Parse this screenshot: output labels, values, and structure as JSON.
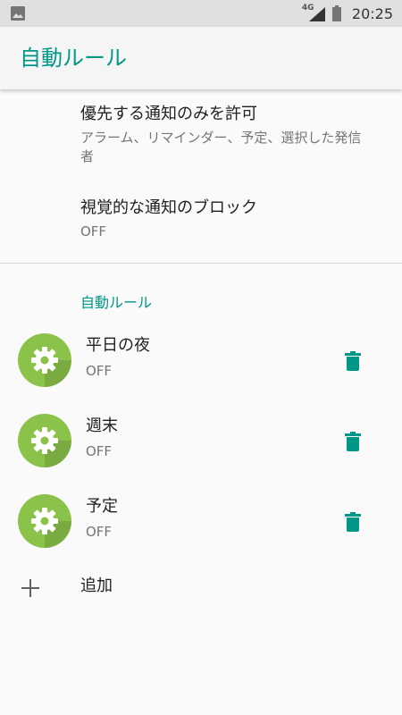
{
  "status_bar": {
    "network_label": "4G",
    "time": "20:25",
    "icons": [
      "image-notification-icon",
      "signal-icon",
      "battery-icon"
    ]
  },
  "app_bar": {
    "title": "自動ルール"
  },
  "settings": [
    {
      "title": "優先する通知のみを許可",
      "summary": "アラーム、リマインダー、予定、選択した発信者"
    },
    {
      "title": "視覚的な通知のブロック",
      "summary": "OFF"
    }
  ],
  "rules_section": {
    "header": "自動ルール",
    "rules": [
      {
        "name": "平日の夜",
        "status": "OFF"
      },
      {
        "name": "週末",
        "status": "OFF"
      },
      {
        "name": "予定",
        "status": "OFF"
      }
    ],
    "add_label": "追加"
  },
  "colors": {
    "accent": "#009688",
    "rule_icon_bg": "#8bc34a",
    "status_bar_bg": "#e0e0e0",
    "app_bar_bg": "#f5f5f5",
    "background": "#fafafa"
  }
}
